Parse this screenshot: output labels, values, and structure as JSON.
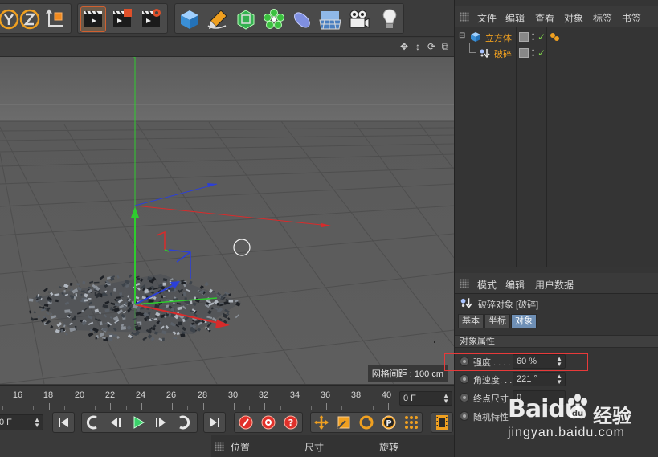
{
  "viewport": {
    "grid_spacing": "网格间距 : 100 cm"
  },
  "timeline": {
    "ticks": [
      "16",
      "18",
      "20",
      "22",
      "24",
      "26",
      "28",
      "30",
      "32",
      "34",
      "36",
      "38",
      "40"
    ],
    "frame_field": "0 F"
  },
  "transport": {
    "start_field": "0 F"
  },
  "coords": {
    "position": "位置",
    "size": "尺寸",
    "rotation": "旋转"
  },
  "object_manager": {
    "menu": [
      "文件",
      "编辑",
      "查看",
      "对象",
      "标签",
      "书签"
    ],
    "objects": [
      {
        "name": "立方体"
      },
      {
        "name": "破碎"
      }
    ]
  },
  "attributes": {
    "menu": [
      "模式",
      "编辑",
      "用户数据"
    ],
    "object_title": "破碎对象 [破碎]",
    "tabs": [
      "基本",
      "坐标",
      "对象"
    ],
    "active_tab": "对象",
    "section": "对象属性",
    "props": [
      {
        "label": "强度 . . . .",
        "value": "60 %"
      },
      {
        "label": "角速度. . . .",
        "value": "221 °"
      },
      {
        "label": "终点尺寸",
        "value": "0"
      },
      {
        "label": "随机特性",
        "value": ""
      }
    ]
  },
  "watermark": {
    "brand": "Baidu",
    "brand_cn": "经验",
    "url": "jingyan.baidu.com"
  },
  "colors": {
    "accent_tab": "#6e8fb5",
    "object_name": "#f0a020",
    "highlight": "#e83a3a",
    "axis_x": "#d92b2b",
    "axis_y": "#2ecc2e",
    "axis_z": "#2b3fd9"
  },
  "icons": [
    "rotate-y-icon",
    "z-axis-icon",
    "coordinate-system-icon",
    "render-view-icon",
    "render-picture-viewer-icon",
    "edit-render-settings-icon",
    "cube-icon",
    "pen-icon",
    "subdivision-icon",
    "cloner-icon",
    "deformer-icon",
    "floor-icon",
    "camera-icon",
    "light-icon"
  ]
}
